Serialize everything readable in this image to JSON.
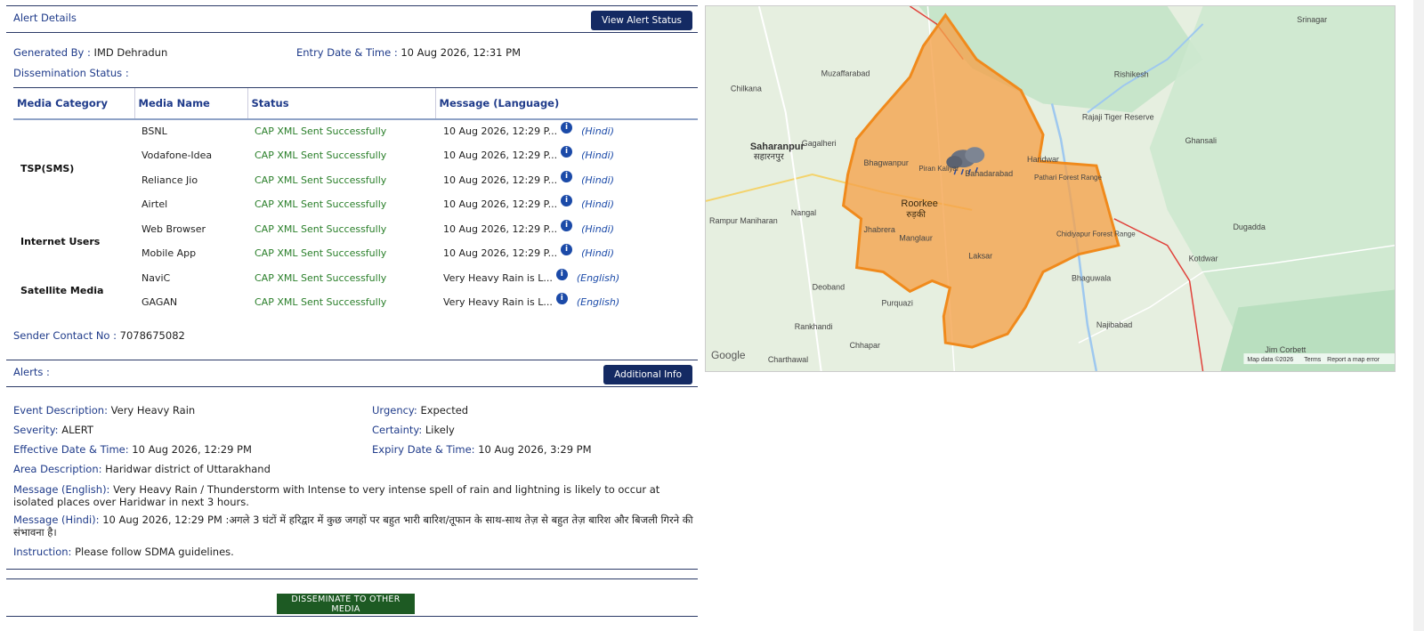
{
  "alert_details": {
    "title": "Alert Details",
    "view_status_button": "View Alert Status",
    "generated_by_label": "Generated By :",
    "generated_by": "IMD Dehradun",
    "entry_label": "Entry Date & Time :",
    "entry_value": "10 Aug 2026, 12:31 PM",
    "dissemination_label": "Dissemination Status :",
    "sender_label": "Sender Contact No :",
    "sender_value": "7078675082"
  },
  "media_table": {
    "headers": [
      "Media Category",
      "Media Name",
      "Status",
      "Message (Language)"
    ],
    "categories": [
      "TSP(SMS)",
      "Internet Users",
      "Satellite Media"
    ],
    "rows": [
      {
        "name": "BSNL",
        "status": "CAP XML Sent Successfully",
        "message": "10 Aug 2026, 12:29 P...",
        "lang": "(Hindi)"
      },
      {
        "name": "Vodafone-Idea",
        "status": "CAP XML Sent Successfully",
        "message": "10 Aug 2026, 12:29 P...",
        "lang": "(Hindi)"
      },
      {
        "name": "Reliance Jio",
        "status": "CAP XML Sent Successfully",
        "message": "10 Aug 2026, 12:29 P...",
        "lang": "(Hindi)"
      },
      {
        "name": "Airtel",
        "status": "CAP XML Sent Successfully",
        "message": "10 Aug 2026, 12:29 P...",
        "lang": "(Hindi)"
      },
      {
        "name": "Web Browser",
        "status": "CAP XML Sent Successfully",
        "message": "10 Aug 2026, 12:29 P...",
        "lang": "(Hindi)"
      },
      {
        "name": "Mobile App",
        "status": "CAP XML Sent Successfully",
        "message": "10 Aug 2026, 12:29 P...",
        "lang": "(Hindi)"
      },
      {
        "name": "NaviC",
        "status": "CAP XML Sent Successfully",
        "message": "Very Heavy Rain is L...",
        "lang": "(English)"
      },
      {
        "name": "GAGAN",
        "status": "CAP XML Sent Successfully",
        "message": "Very Heavy Rain is L...",
        "lang": "(English)"
      }
    ]
  },
  "alerts": {
    "title": "Alerts :",
    "additional_button": "Additional Info",
    "event_label": "Event Description:",
    "event_value": "Very Heavy Rain",
    "urgency_label": "Urgency:",
    "urgency_value": "Expected",
    "severity_label": "Severity:",
    "severity_value": "ALERT",
    "certainty_label": "Certainty:",
    "certainty_value": "Likely",
    "effective_label": "Effective Date & Time:",
    "effective_value": "10 Aug 2026, 12:29 PM",
    "expiry_label": "Expiry Date & Time:",
    "expiry_value": "10 Aug 2026, 3:29 PM",
    "area_label": "Area Description:",
    "area_value": "Haridwar district of Uttarakhand",
    "msg_en_label": "Message (English):",
    "msg_en_value": "Very Heavy Rain / Thunderstorm with Intense to very intense spell of rain and lightning is likely to occur at isolated places over Haridwar in next 3 hours.",
    "msg_hi_label": "Message (Hindi):",
    "msg_hi_value": "10 Aug 2026, 12:29 PM :अगले 3 घंटों में हरिद्वार में कुछ जगहों पर बहुत भारी बारिश/तूफान के साथ-साथ तेज़ से बहुत तेज़ बारिश और बिजली गिरने की संभावना है।",
    "instruction_label": "Instruction:",
    "instruction_value": "Please follow SDMA guidelines.",
    "disseminate_button": "DISSEMINATE TO OTHER MEDIA"
  },
  "map": {
    "labels": {
      "saharanpur": "Saharanpur",
      "saharanpur_hi": "सहारनपुर",
      "roorkee": "Roorkee",
      "roorkee_hi": "रुड़की",
      "haridwar": "Haridwar",
      "laksar": "Laksar",
      "muzaffarabad": "Muzaffarabad",
      "chilkana": "Chilkana",
      "gagalheri": "Gagalheri",
      "rajaji": "Rajaji Tiger Reserve",
      "rishikesh": "Rishikesh",
      "bahadarabad": "Bahadarabad",
      "bhagwanpur": "Bhagwanpur",
      "jhabrera": "Jhabrera",
      "manglaur": "Manglaur",
      "nangal": "Nangal",
      "rampur": "Rampur Maniharan",
      "deoband": "Deoband",
      "purquazi": "Purquazi",
      "najibabad": "Najibabad",
      "kotdwar": "Kotdwar",
      "bhaguwala": "Bhaguwala",
      "dugadda": "Dugadda",
      "ghansali": "Ghansali",
      "srinagar": "Srinagar",
      "jim_corbett": "Jim Corbett",
      "chidiyapur": "Chidiyapur Forest Range",
      "pathari": "Pathari Forest Range",
      "piran_kaliyar": "Piran Kaliyar",
      "rankhandi": "Rankhandi",
      "chhapar": "Chhapar",
      "charthawal": "Charthawal"
    },
    "google": "Google",
    "footer": "Map data ©2026",
    "terms": "Terms",
    "report": "Report a map error"
  },
  "colors": {
    "navy": "#142a63",
    "green_status": "#2a7f2a",
    "orange_fill": "#f5a24a",
    "orange_stroke": "#f08a1c"
  }
}
